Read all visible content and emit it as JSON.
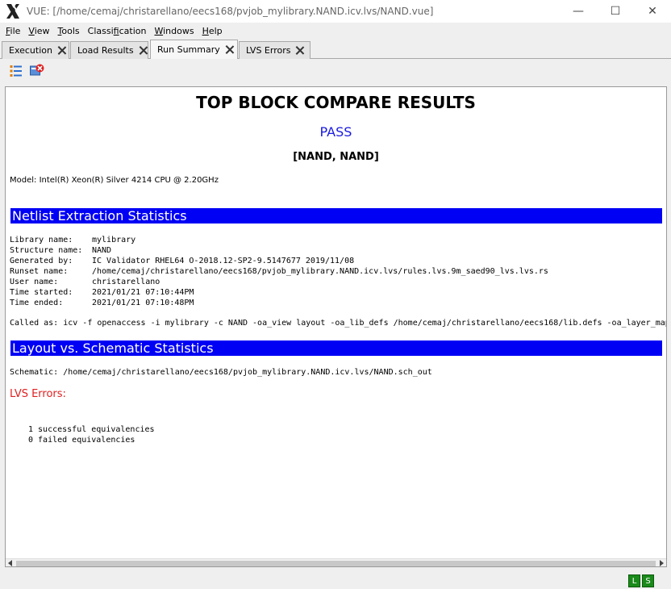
{
  "window": {
    "title": "VUE: [/home/cemaj/christarellano/eecs168/pvjob_mylibrary.NAND.icv.lvs/NAND.vue]",
    "minimize": "—",
    "maximize": "☐",
    "close": "✕"
  },
  "menu": [
    {
      "label_u": "F",
      "label_rest": "ile"
    },
    {
      "label_u": "V",
      "label_rest": "iew"
    },
    {
      "label_u": "T",
      "label_rest": "ools"
    },
    {
      "label_pre": "Classi",
      "label_u": "f",
      "label_rest": "ication"
    },
    {
      "label_u": "W",
      "label_rest": "indows"
    },
    {
      "label_u": "H",
      "label_rest": "elp"
    }
  ],
  "tabs": [
    {
      "label": "Execution",
      "active": false
    },
    {
      "label": "Load Results",
      "active": false
    },
    {
      "label": "Run Summary",
      "active": true
    },
    {
      "label": "LVS Errors",
      "active": false
    }
  ],
  "toolbar": {
    "icons": [
      "list-icon",
      "stop-run-icon"
    ]
  },
  "report": {
    "title": "TOP BLOCK COMPARE RESULTS",
    "result": "PASS",
    "result_color": "#1a1adf",
    "cells": "[NAND, NAND]",
    "model": "Model: Intel(R) Xeon(R) Silver 4214 CPU @ 2.20GHz",
    "netlist_header": "Netlist Extraction Statistics",
    "info": [
      {
        "key": "Library name:",
        "value": "mylibrary"
      },
      {
        "key": "Structure name:",
        "value": "NAND"
      },
      {
        "key": "Generated by:",
        "value": "IC Validator RHEL64 O-2018.12-SP2-9.5147677 2019/11/08"
      },
      {
        "key": "Runset name:",
        "value": "/home/cemaj/christarellano/eecs168/pvjob_mylibrary.NAND.icv.lvs/rules.lvs.9m_saed90_lvs.lvs.rs"
      },
      {
        "key": "User name:",
        "value": "christarellano"
      },
      {
        "key": "Time started:",
        "value": "2021/01/21 07:10:44PM"
      },
      {
        "key": "Time ended:",
        "value": "2021/01/21 07:10:48PM"
      }
    ],
    "called_as": "Called as: icv -f openaccess -i mylibrary -c NAND -oa_view layout -oa_lib_defs /home/cemaj/christarellano/eecs168/lib.defs -oa_layer_map",
    "lvs_header": "Layout vs. Schematic Statistics",
    "schematic": "Schematic: /home/cemaj/christarellano/eecs168/pvjob_mylibrary.NAND.icv.lvs/NAND.sch_out",
    "lvs_errors_label": "LVS Errors:",
    "lvs_errors_color": "#e02020",
    "successful": "1 successful equivalencies",
    "failed": "0 failed equivalencies"
  },
  "status": {
    "left_badge": "L",
    "right_badge": "S",
    "badge_color": "#1a8a1a"
  }
}
